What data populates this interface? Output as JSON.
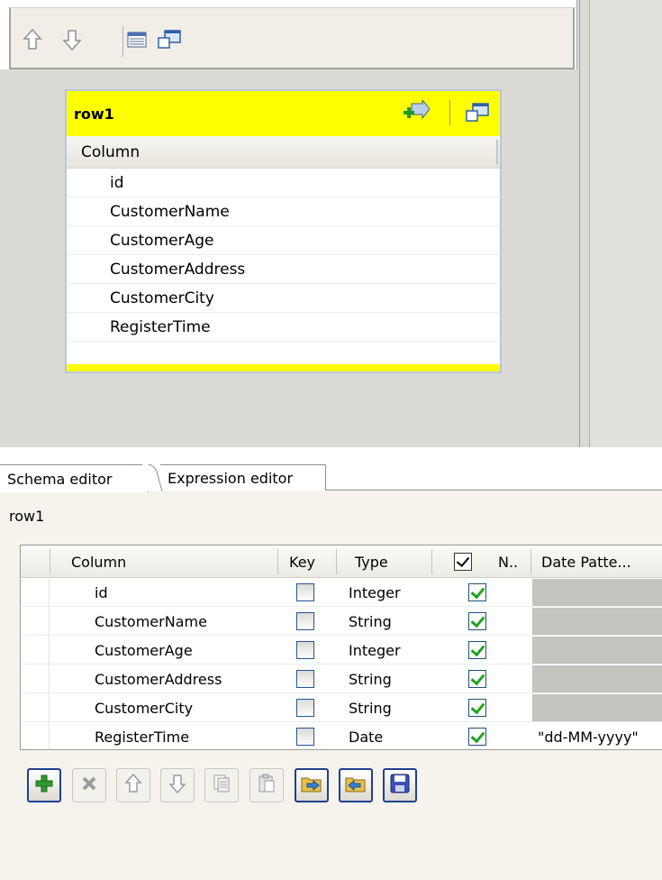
{
  "card": {
    "title": "row1",
    "column_header": "Column",
    "rows": [
      "id",
      "CustomerName",
      "CustomerAge",
      "CustomerAddress",
      "CustomerCity",
      "RegisterTime"
    ]
  },
  "tabs": [
    {
      "label": "Schema editor",
      "active": true
    },
    {
      "label": "Expression editor",
      "active": false
    }
  ],
  "schema": {
    "name": "row1",
    "headers": {
      "column": "Column",
      "key": "Key",
      "type": "Type",
      "nullable": "N..",
      "date_pattern": "Date Patte..."
    },
    "rows": [
      {
        "column": "id",
        "key": false,
        "type": "Integer",
        "nullable": true,
        "date_pattern": ""
      },
      {
        "column": "CustomerName",
        "key": false,
        "type": "String",
        "nullable": true,
        "date_pattern": ""
      },
      {
        "column": "CustomerAge",
        "key": false,
        "type": "Integer",
        "nullable": true,
        "date_pattern": ""
      },
      {
        "column": "CustomerAddress",
        "key": false,
        "type": "String",
        "nullable": true,
        "date_pattern": ""
      },
      {
        "column": "CustomerCity",
        "key": false,
        "type": "String",
        "nullable": true,
        "date_pattern": ""
      },
      {
        "column": "RegisterTime",
        "key": false,
        "type": "Date",
        "nullable": true,
        "date_pattern": "\"dd-MM-yyyy\""
      }
    ]
  },
  "toolbar_icons": {
    "top": [
      "move-up-icon",
      "move-down-icon",
      "table-view-icon",
      "window-icon"
    ],
    "bottom": [
      "add-icon",
      "delete-icon",
      "move-up-icon",
      "move-down-icon",
      "copy-icon",
      "paste-icon",
      "import-icon",
      "export-icon",
      "save-icon"
    ]
  },
  "colors": {
    "card_header": "#ffff00",
    "check_green": "#21a121",
    "accent_blue": "#1f3f8f"
  }
}
